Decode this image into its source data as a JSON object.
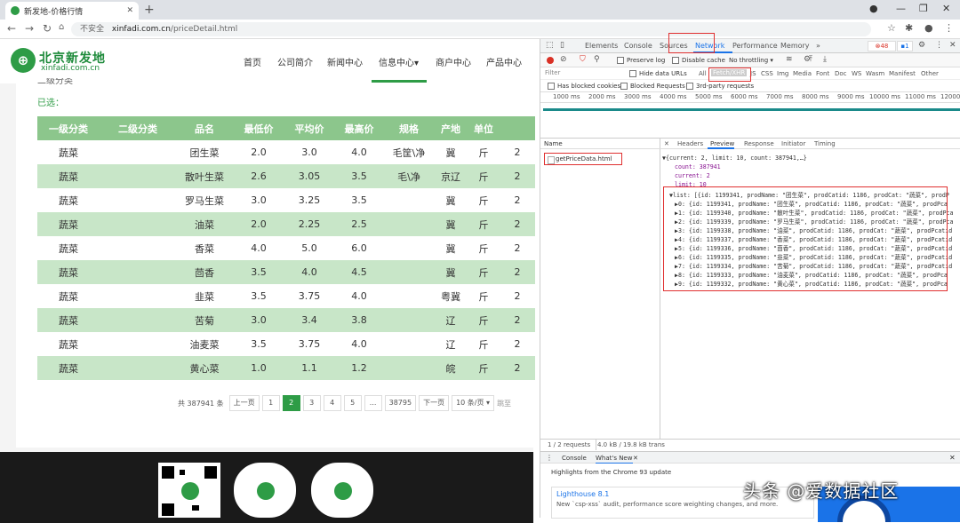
{
  "browser": {
    "tab_title": "新发地-价格行情",
    "url_security": "不安全",
    "url_host": "xinfadi.com.cn",
    "url_path": "/priceDetail.html"
  },
  "site": {
    "logo_cn": "北京新发地",
    "logo_en": "xinfadi.com.cn",
    "nav": [
      "首页",
      "公司简介",
      "新闻中心",
      "信息中心▾",
      "商户中心",
      "产品中心"
    ],
    "secondary_filter_label": "二级分类",
    "selected_label": "已选：",
    "table_headers": [
      "一级分类",
      "二级分类",
      "品名",
      "最低价",
      "平均价",
      "最高价",
      "规格",
      "产地",
      "单位",
      ""
    ],
    "rows": [
      [
        "蔬菜",
        "",
        "团生菜",
        "2.0",
        "3.0",
        "4.0",
        "毛筐\\净",
        "冀",
        "斤",
        "2"
      ],
      [
        "蔬菜",
        "",
        "散叶生菜",
        "2.6",
        "3.05",
        "3.5",
        "毛\\净",
        "京辽",
        "斤",
        "2"
      ],
      [
        "蔬菜",
        "",
        "罗马生菜",
        "3.0",
        "3.25",
        "3.5",
        "",
        "冀",
        "斤",
        "2"
      ],
      [
        "蔬菜",
        "",
        "油菜",
        "2.0",
        "2.25",
        "2.5",
        "",
        "冀",
        "斤",
        "2"
      ],
      [
        "蔬菜",
        "",
        "香菜",
        "4.0",
        "5.0",
        "6.0",
        "",
        "冀",
        "斤",
        "2"
      ],
      [
        "蔬菜",
        "",
        "茴香",
        "3.5",
        "4.0",
        "4.5",
        "",
        "冀",
        "斤",
        "2"
      ],
      [
        "蔬菜",
        "",
        "韭菜",
        "3.5",
        "3.75",
        "4.0",
        "",
        "粤冀",
        "斤",
        "2"
      ],
      [
        "蔬菜",
        "",
        "苦菊",
        "3.0",
        "3.4",
        "3.8",
        "",
        "辽",
        "斤",
        "2"
      ],
      [
        "蔬菜",
        "",
        "油麦菜",
        "3.5",
        "3.75",
        "4.0",
        "",
        "辽",
        "斤",
        "2"
      ],
      [
        "蔬菜",
        "",
        "黄心菜",
        "1.0",
        "1.1",
        "1.2",
        "",
        "皖",
        "斤",
        "2"
      ]
    ],
    "pager": {
      "total": "共 387941 条",
      "prev": "上一页",
      "pages": [
        "1",
        "2",
        "3",
        "4",
        "5",
        "...",
        "38795"
      ],
      "current": "2",
      "next": "下一页",
      "per_page": "10 条/页 ▾",
      "goto": "跳至"
    }
  },
  "devtools": {
    "tabs": [
      "Elements",
      "Console",
      "Sources",
      "Network",
      "Performance",
      "Memory",
      "»"
    ],
    "active_tab": "Network",
    "errors": "⊗48",
    "messages": "▪1",
    "toolbar": {
      "preserve_log": "Preserve log",
      "disable_cache": "Disable cache",
      "throttling": "No throttling"
    },
    "filter_placeholder": "Filter",
    "hide_data_urls": "Hide data URLs",
    "filter_types": [
      "All",
      "Fetch/XHR",
      "JS",
      "CSS",
      "Img",
      "Media",
      "Font",
      "Doc",
      "WS",
      "Wasm",
      "Manifest",
      "Other"
    ],
    "has_blocked_cookies": "Has blocked cookies",
    "blocked_requests": "Blocked Requests",
    "third_party": "3rd-party requests",
    "timeline_ticks": [
      "1000 ms",
      "2000 ms",
      "3000 ms",
      "4000 ms",
      "5000 ms",
      "6000 ms",
      "7000 ms",
      "8000 ms",
      "9000 ms",
      "10000 ms",
      "11000 ms",
      "12000"
    ],
    "name_header": "Name",
    "request_name": "getPriceData.html",
    "detail_tabs": [
      "Headers",
      "Preview",
      "Response",
      "Initiator",
      "Timing"
    ],
    "detail_close": "✕",
    "json": {
      "summary": "▼{current: 2, limit: 10, count: 387941,…}",
      "count": "count: 387941",
      "current": "current: 2",
      "limit": "limit: 10",
      "list_head": "▼list: [{id: 1199341, prodName: \"团生菜\", prodCatid: 1186, prodCat: \"蔬菜\", prodP",
      "items": [
        "▶0: {id: 1199341, prodName: \"团生菜\", prodCatid: 1186, prodCat: \"蔬菜\", prodPca",
        "▶1: {id: 1199340, prodName: \"散叶生菜\", prodCatid: 1186, prodCat: \"蔬菜\", prodPca",
        "▶2: {id: 1199339, prodName: \"罗马生菜\", prodCatid: 1186, prodCat: \"蔬菜\", prodPca",
        "▶3: {id: 1199338, prodName: \"油菜\", prodCatid: 1186, prodCat: \"蔬菜\", prodPcatid",
        "▶4: {id: 1199337, prodName: \"香菜\", prodCatid: 1186, prodCat: \"蔬菜\", prodPcatid",
        "▶5: {id: 1199336, prodName: \"茴香\", prodCatid: 1186, prodCat: \"蔬菜\", prodPcatid",
        "▶6: {id: 1199335, prodName: \"韭菜\", prodCatid: 1186, prodCat: \"蔬菜\", prodPcatid",
        "▶7: {id: 1199334, prodName: \"苦菊\", prodCatid: 1186, prodCat: \"蔬菜\", prodPcatid",
        "▶8: {id: 1199333, prodName: \"油麦菜\", prodCatid: 1186, prodCat: \"蔬菜\", prodPca",
        "▶9: {id: 1199332, prodName: \"黄心菜\", prodCatid: 1186, prodCat: \"蔬菜\", prodPca"
      ]
    },
    "status": "1 / 2 requests",
    "transferred": "4.0 kB / 19.8 kB trans",
    "drawer_tabs": [
      "Console",
      "What's New"
    ],
    "drawer_close": "✕",
    "highlights": "Highlights from the Chrome 93 update",
    "lighthouse_title": "Lighthouse 8.1",
    "lighthouse_text": "New `csp-xss` audit, performance score weighting changes, and more."
  },
  "watermark": "头条 @爱数据社区",
  "colors": {
    "brand_green": "#2e9c46",
    "header_green": "#8cc68c",
    "row_alt": "#c8e6c8",
    "highlight_red": "#e03030",
    "devtools_blue": "#1a73e8"
  }
}
